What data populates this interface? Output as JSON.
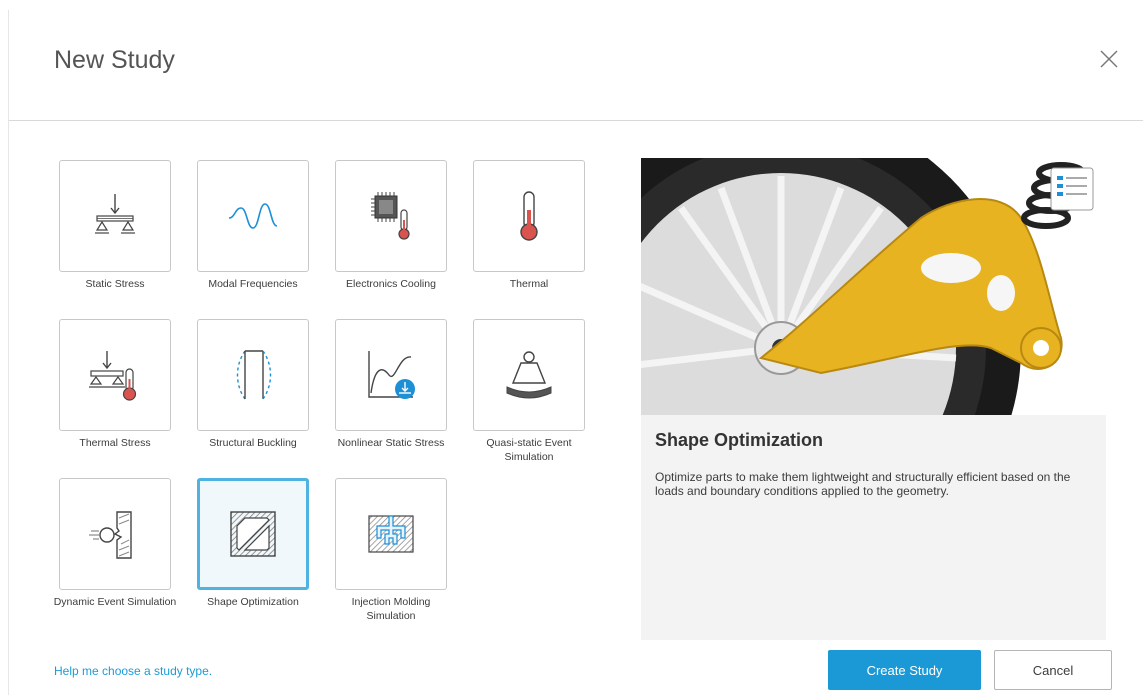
{
  "dialog": {
    "title": "New Study",
    "close_icon": "close-icon"
  },
  "study_types": [
    {
      "label": "Static Stress",
      "icon": "static-stress-icon"
    },
    {
      "label": "Modal Frequencies",
      "icon": "modal-frequencies-icon"
    },
    {
      "label": "Electronics Cooling",
      "icon": "electronics-cooling-icon"
    },
    {
      "label": "Thermal",
      "icon": "thermometer-icon"
    },
    {
      "label": "Thermal Stress",
      "icon": "thermal-stress-icon"
    },
    {
      "label": "Structural Buckling",
      "icon": "structural-buckling-icon"
    },
    {
      "label": "Nonlinear Static Stress",
      "icon": "nonlinear-static-stress-icon"
    },
    {
      "label": "Quasi-static Event Simulation",
      "icon": "quasi-static-event-icon"
    },
    {
      "label": "Dynamic Event Simulation",
      "icon": "dynamic-event-icon"
    },
    {
      "label": "Shape Optimization",
      "icon": "shape-optimization-icon",
      "selected": true
    },
    {
      "label": "Injection Molding Simulation",
      "icon": "injection-molding-icon"
    }
  ],
  "preview": {
    "title": "Shape Optimization",
    "description": "Optimize parts to make them lightweight and structurally efficient based on the loads and boundary conditions applied to the geometry.",
    "image": "wheel-suspension-arm-image"
  },
  "footer": {
    "help_link": "Help me choose a study type.",
    "create_label": "Create Study",
    "cancel_label": "Cancel"
  },
  "colors": {
    "accent": "#1b99d6",
    "selected_border": "#4eb3e0",
    "icon_blue": "#1c8fd6",
    "thermo_red": "#d9534f"
  }
}
